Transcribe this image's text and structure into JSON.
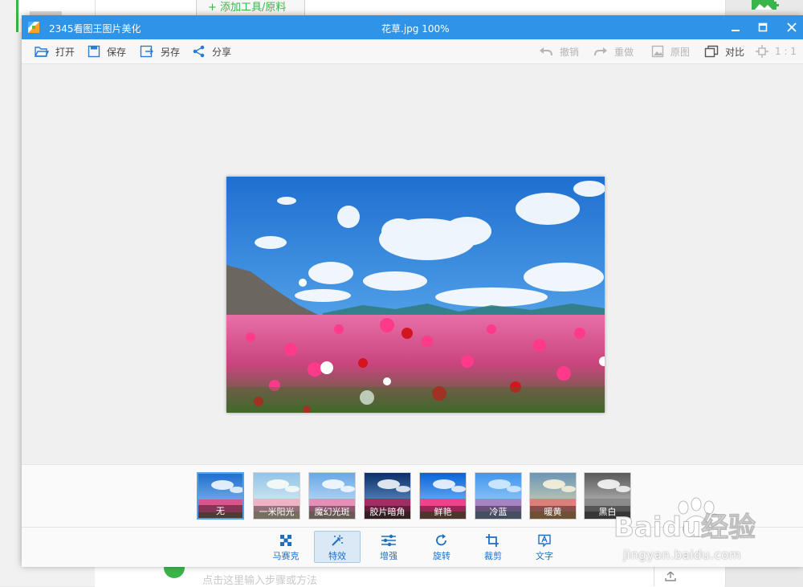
{
  "background_app": {
    "add_tool_label": "+ 添加工具/原料",
    "bottom_hint": "点击这里输入步骤或方法"
  },
  "window": {
    "app_name": "2345看图王图片美化",
    "file_title": "花草.jpg  100%",
    "controls": {
      "minimize": "minimize-icon",
      "maximize": "maximize-icon",
      "close": "close-icon"
    }
  },
  "toolbar": {
    "open": "打开",
    "save": "保存",
    "save_as": "另存",
    "share": "分享",
    "undo": "撤销",
    "redo": "重做",
    "original": "原图",
    "compare": "对比",
    "actual_size": "1 : 1"
  },
  "filters": [
    {
      "label": "无",
      "selected": true
    },
    {
      "label": "一米阳光",
      "selected": false
    },
    {
      "label": "魔幻光斑",
      "selected": false
    },
    {
      "label": "胶片暗角",
      "selected": false
    },
    {
      "label": "鲜艳",
      "selected": false
    },
    {
      "label": "冷蓝",
      "selected": false
    },
    {
      "label": "暖黄",
      "selected": false
    },
    {
      "label": "黑白",
      "selected": false
    }
  ],
  "tools": {
    "mosaic": "马赛克",
    "effects": "特效",
    "enhance": "增强",
    "rotate": "旋转",
    "crop": "裁剪",
    "text": "文字",
    "active": "effects"
  },
  "watermark": {
    "brand": "Baidu经验",
    "url": "jingyan.baidu.com"
  },
  "colors": {
    "titlebar": "#2f93e8",
    "accent": "#1e6fc3",
    "selected_border": "#55a3e6",
    "green": "#3ab54a"
  }
}
